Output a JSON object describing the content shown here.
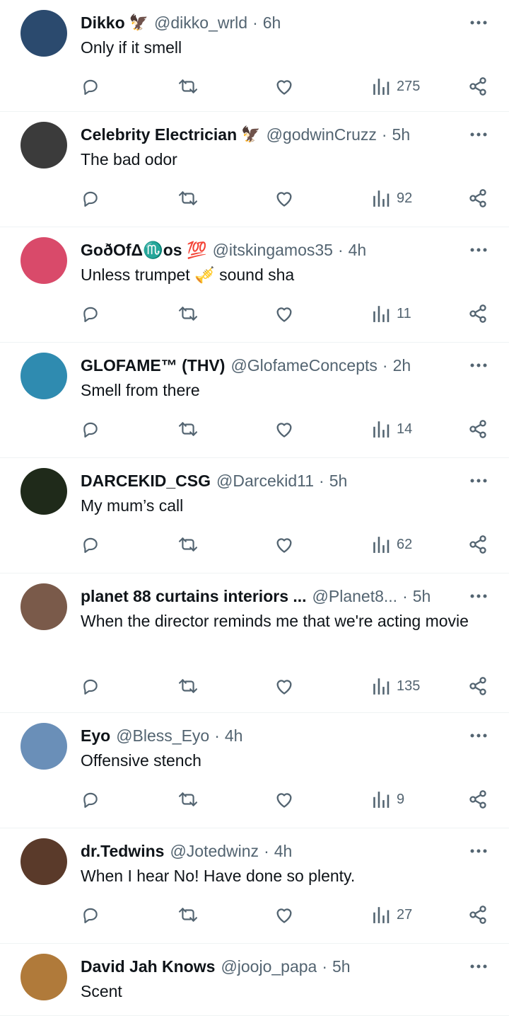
{
  "colors": {
    "text": "#0f1419",
    "secondary": "#536471",
    "divider": "#eff3f4"
  },
  "icons": {
    "reply": "reply-icon",
    "repost": "repost-icon",
    "like": "heart-icon",
    "views": "views-icon",
    "share": "share-icon",
    "more": "more-icon"
  },
  "replies": [
    {
      "name": "Dikko",
      "badge": "🦅",
      "handle": "@dikko_wrld",
      "separator": "·",
      "time": "6h",
      "text": "Only if it smell",
      "views": "275",
      "avatar_color": "#2b4a6e"
    },
    {
      "name": "Celebrity Electrician",
      "badge": "🦅",
      "handle": "@godwinCruzz",
      "separator": "·",
      "time": "5h",
      "text": "The bad odor",
      "views": "92",
      "avatar_color": "#3b3b3b"
    },
    {
      "name": "GoðOfΔ♏os 💯",
      "badge": "",
      "handle": "@itskingamos35",
      "separator": "·",
      "time": "4h",
      "text": "Unless trumpet 🎺 sound sha",
      "views": "11",
      "avatar_color": "#d94a6a"
    },
    {
      "name": "GLOFAME™ (THV)",
      "badge": "",
      "handle": "@GlofameConcepts",
      "separator": "·",
      "time": "2h",
      "text": "Smell from there",
      "views": "14",
      "avatar_color": "#2f8bb0"
    },
    {
      "name": "DARCEKID_CSG",
      "badge": "",
      "handle": "@Darcekid11",
      "separator": "·",
      "time": "5h",
      "text": "My mum’s call",
      "views": "62",
      "avatar_color": "#1f2a1a"
    },
    {
      "name": "planet 88 curtains interiors ...",
      "badge": "",
      "handle": "@Planet8...",
      "separator": "·",
      "time": "5h",
      "text": "When the director reminds me that we're acting movie",
      "views": "135",
      "avatar_color": "#7a5a4a"
    },
    {
      "name": "Eyo",
      "badge": "",
      "handle": "@Bless_Eyo",
      "separator": "·",
      "time": "4h",
      "text": "Offensive stench",
      "views": "9",
      "avatar_color": "#6a8fb8"
    },
    {
      "name": "dr.Tedwins",
      "badge": "",
      "handle": "@Jotedwinz",
      "separator": "·",
      "time": "4h",
      "text": "When I hear No! Have done so plenty.",
      "views": "27",
      "avatar_color": "#5a3a2a"
    },
    {
      "name": "David Jah Knows",
      "badge": "",
      "handle": "@joojo_papa",
      "separator": "·",
      "time": "5h",
      "text": "Scent",
      "views": "",
      "avatar_color": "#b07a3a"
    }
  ]
}
